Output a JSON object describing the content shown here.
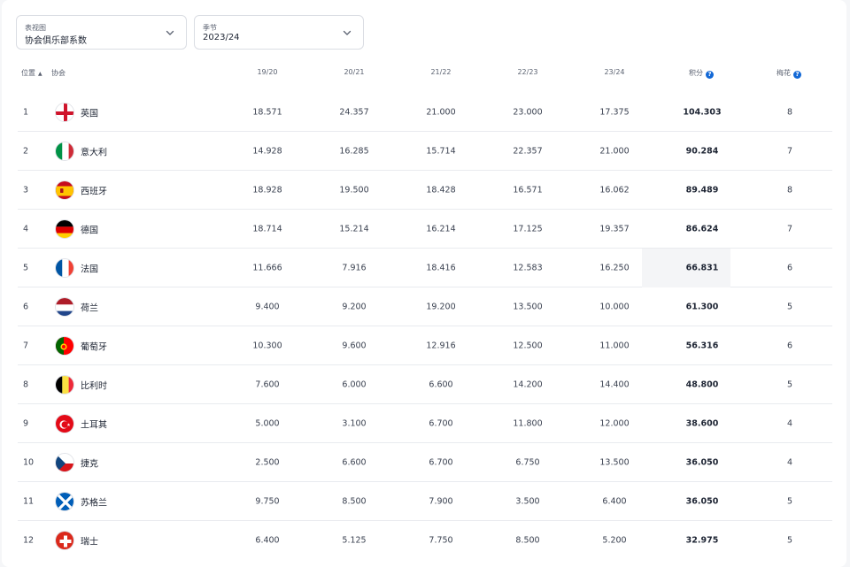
{
  "filters": {
    "view": {
      "label": "表视图",
      "value": "协会俱乐部系数"
    },
    "season": {
      "label": "季节",
      "value": "2023/24"
    }
  },
  "columns": {
    "rank": "位置",
    "association": "协会",
    "y1": "19/20",
    "y2": "20/21",
    "y3": "21/22",
    "y4": "22/23",
    "y5": "23/24",
    "points": "积分",
    "clubs": "梅花"
  },
  "icons": {
    "sort": "sort-ascending-icon",
    "info": "info-icon",
    "dropdown": "chevron-down-icon"
  },
  "colors": {
    "accent": "#1268d6",
    "row_border": "#e9ebef",
    "highlight": "#f4f5f7"
  },
  "rows": [
    {
      "rank": "1",
      "country": "英国",
      "flag": "england",
      "y1": "18.571",
      "y2": "24.357",
      "y3": "21.000",
      "y4": "23.000",
      "y5": "17.375",
      "points": "104.303",
      "clubs": "8"
    },
    {
      "rank": "2",
      "country": "意大利",
      "flag": "italy",
      "y1": "14.928",
      "y2": "16.285",
      "y3": "15.714",
      "y4": "22.357",
      "y5": "21.000",
      "points": "90.284",
      "clubs": "7"
    },
    {
      "rank": "3",
      "country": "西班牙",
      "flag": "spain",
      "y1": "18.928",
      "y2": "19.500",
      "y3": "18.428",
      "y4": "16.571",
      "y5": "16.062",
      "points": "89.489",
      "clubs": "8"
    },
    {
      "rank": "4",
      "country": "德国",
      "flag": "germany",
      "y1": "18.714",
      "y2": "15.214",
      "y3": "16.214",
      "y4": "17.125",
      "y5": "19.357",
      "points": "86.624",
      "clubs": "7"
    },
    {
      "rank": "5",
      "country": "法国",
      "flag": "france",
      "y1": "11.666",
      "y2": "7.916",
      "y3": "18.416",
      "y4": "12.583",
      "y5": "16.250",
      "points": "66.831",
      "clubs": "6"
    },
    {
      "rank": "6",
      "country": "荷兰",
      "flag": "netherlands",
      "y1": "9.400",
      "y2": "9.200",
      "y3": "19.200",
      "y4": "13.500",
      "y5": "10.000",
      "points": "61.300",
      "clubs": "5"
    },
    {
      "rank": "7",
      "country": "葡萄牙",
      "flag": "portugal",
      "y1": "10.300",
      "y2": "9.600",
      "y3": "12.916",
      "y4": "12.500",
      "y5": "11.000",
      "points": "56.316",
      "clubs": "6"
    },
    {
      "rank": "8",
      "country": "比利时",
      "flag": "belgium",
      "y1": "7.600",
      "y2": "6.000",
      "y3": "6.600",
      "y4": "14.200",
      "y5": "14.400",
      "points": "48.800",
      "clubs": "5"
    },
    {
      "rank": "9",
      "country": "土耳其",
      "flag": "turkey",
      "y1": "5.000",
      "y2": "3.100",
      "y3": "6.700",
      "y4": "11.800",
      "y5": "12.000",
      "points": "38.600",
      "clubs": "4"
    },
    {
      "rank": "10",
      "country": "捷克",
      "flag": "czechia",
      "y1": "2.500",
      "y2": "6.600",
      "y3": "6.700",
      "y4": "6.750",
      "y5": "13.500",
      "points": "36.050",
      "clubs": "4"
    },
    {
      "rank": "11",
      "country": "苏格兰",
      "flag": "scotland",
      "y1": "9.750",
      "y2": "8.500",
      "y3": "7.900",
      "y4": "3.500",
      "y5": "6.400",
      "points": "36.050",
      "clubs": "5"
    },
    {
      "rank": "12",
      "country": "瑞士",
      "flag": "switzerland",
      "y1": "6.400",
      "y2": "5.125",
      "y3": "7.750",
      "y4": "8.500",
      "y5": "5.200",
      "points": "32.975",
      "clubs": "5"
    }
  ]
}
